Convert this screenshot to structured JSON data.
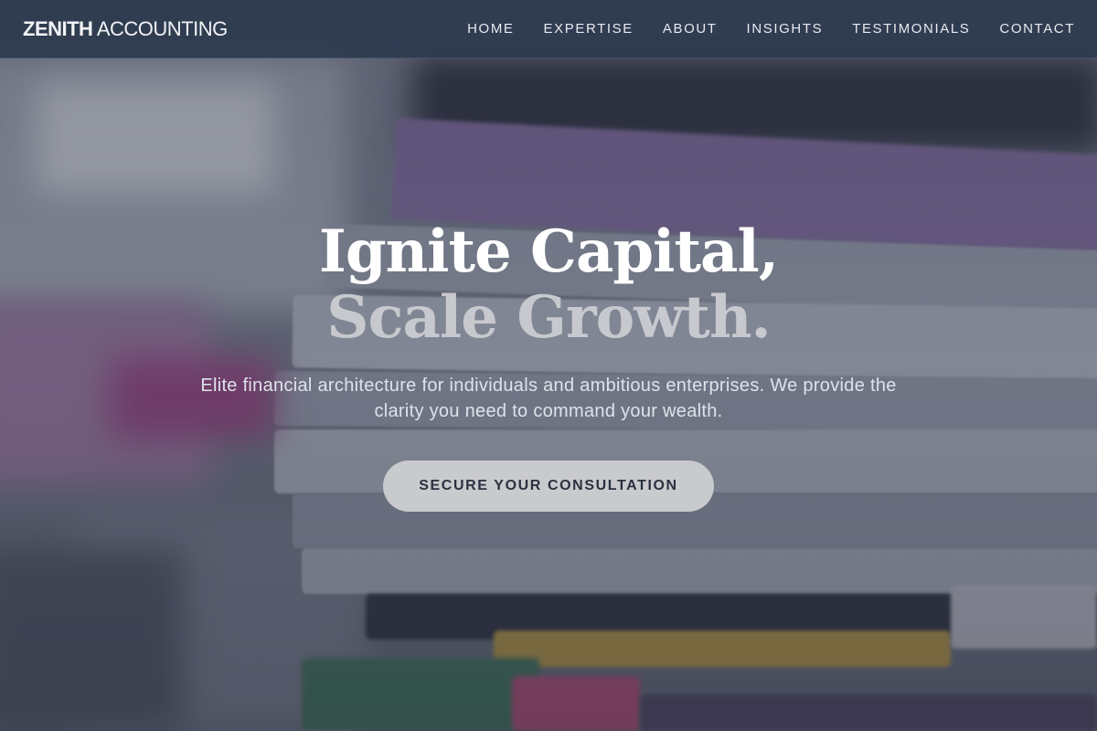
{
  "brand": {
    "bold": "ZENITH",
    "light": " ACCOUNTING"
  },
  "nav": {
    "items": [
      "HOME",
      "EXPERTISE",
      "ABOUT",
      "INSIGHTS",
      "TESTIMONIALS",
      "CONTACT"
    ]
  },
  "hero": {
    "title_line1": "Ignite Capital,",
    "title_line2": "Scale Growth.",
    "subtitle": "Elite financial architecture for individuals and ambitious enterprises. We provide the clarity you need to command your wealth.",
    "cta_label": "SECURE YOUR CONSULTATION"
  },
  "colors": {
    "nav_bg": "#2d3a4e",
    "cta_bg": "#c9cacd",
    "title_primary": "#ffffff",
    "title_secondary": "#c8c9ce"
  }
}
